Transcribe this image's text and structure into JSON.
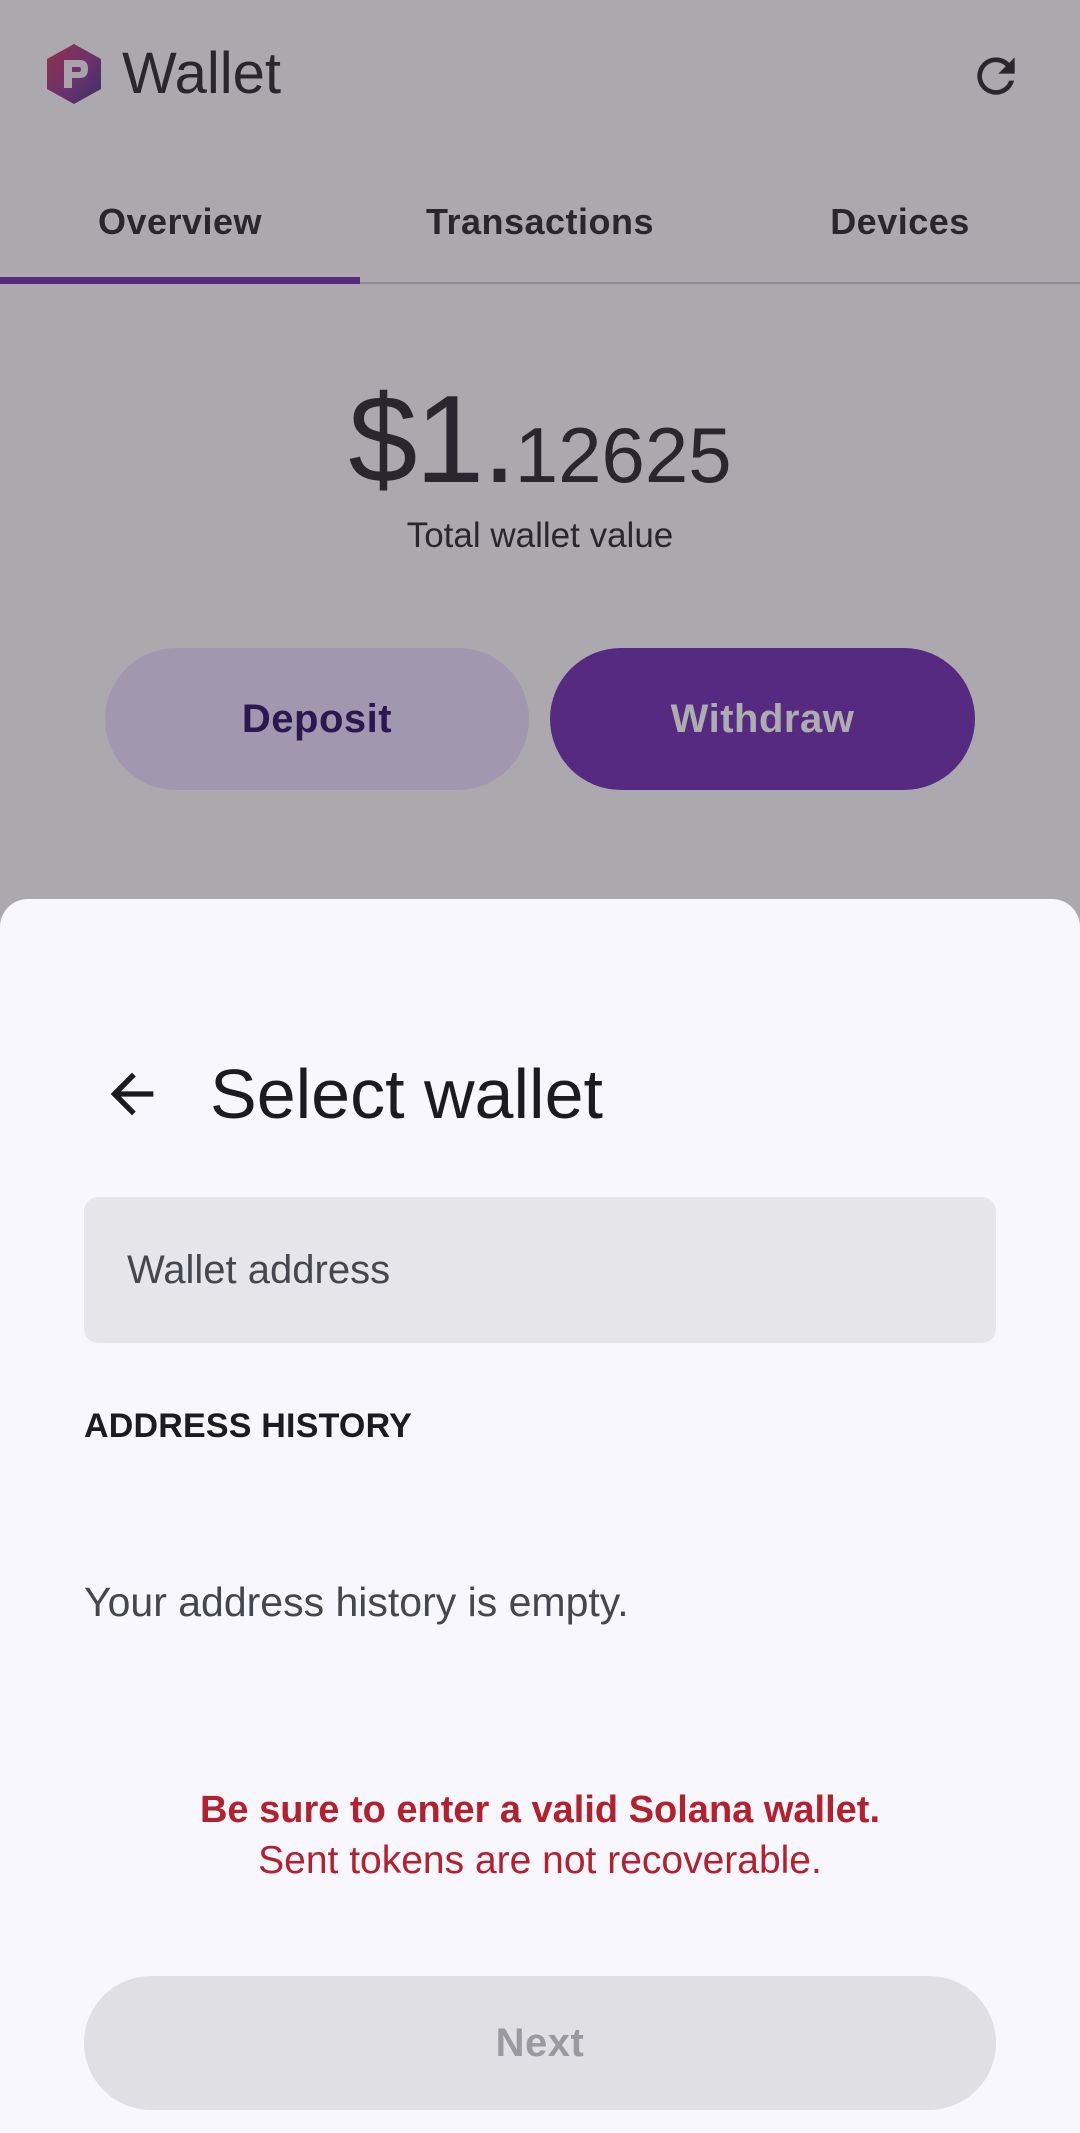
{
  "app": {
    "title": "Wallet",
    "logo_icon": "hexagon-logo-icon",
    "refresh_icon": "refresh-icon"
  },
  "tabs": [
    {
      "label": "Overview",
      "active": true
    },
    {
      "label": "Transactions",
      "active": false
    },
    {
      "label": "Devices",
      "active": false
    }
  ],
  "balance": {
    "integer_part": "$1.",
    "decimal_part": "12625",
    "label": "Total wallet value"
  },
  "actions": {
    "deposit_label": "Deposit",
    "withdraw_label": "Withdraw"
  },
  "sheet": {
    "back_icon": "arrow-left-icon",
    "title": "Select wallet",
    "address_placeholder": "Wallet address",
    "address_value": "",
    "history_title": "ADDRESS HISTORY",
    "history_empty": "Your address history is empty.",
    "warning_bold": "Be sure to enter a valid Solana wallet.",
    "warning_text": "Sent tokens are not recoverable.",
    "next_label": "Next",
    "next_enabled": false
  },
  "colors": {
    "accent": "#6a1fb0",
    "secondary_container": "#eaddff",
    "warning": "#b3202e",
    "sheet_bg": "#f8f7fd"
  }
}
